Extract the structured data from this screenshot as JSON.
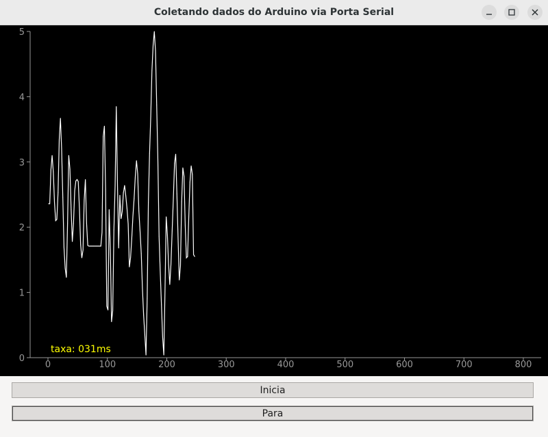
{
  "window": {
    "title": "Coletando dados do Arduino via Porta Serial",
    "controls": [
      "minimize-icon",
      "maximize-icon",
      "close-icon"
    ]
  },
  "plot": {
    "rate_text": "taxa: 031ms",
    "colors": {
      "background": "#000000",
      "line": "#ffffff",
      "axis": "#999999",
      "rate_text": "#ffff00"
    }
  },
  "buttons": {
    "start_label": "Inicia",
    "stop_label": "Para"
  },
  "chart_data": {
    "type": "line",
    "title": "",
    "xlabel": "",
    "ylabel": "",
    "xlim": [
      -30,
      820
    ],
    "ylim": [
      0,
      5
    ],
    "xticks": [
      0,
      100,
      200,
      300,
      400,
      500,
      600,
      700,
      800
    ],
    "yticks": [
      0,
      1,
      2,
      3,
      4,
      5
    ],
    "grid": false,
    "series": [
      {
        "values": [
          [
            1,
            2.36
          ],
          [
            3,
            2.36
          ],
          [
            5,
            2.88
          ],
          [
            7,
            3.1
          ],
          [
            9,
            2.85
          ],
          [
            11,
            2.38
          ],
          [
            13,
            2.1
          ],
          [
            15,
            2.12
          ],
          [
            17,
            2.53
          ],
          [
            19,
            3.34
          ],
          [
            21,
            3.67
          ],
          [
            23,
            3.2
          ],
          [
            25,
            2.46
          ],
          [
            27,
            1.69
          ],
          [
            29,
            1.37
          ],
          [
            31,
            1.23
          ],
          [
            33,
            2.06
          ],
          [
            35,
            3.1
          ],
          [
            37,
            2.89
          ],
          [
            39,
            2.27
          ],
          [
            41,
            1.78
          ],
          [
            43,
            2.06
          ],
          [
            45,
            2.56
          ],
          [
            47,
            2.71
          ],
          [
            49,
            2.73
          ],
          [
            51,
            2.7
          ],
          [
            53,
            2.28
          ],
          [
            55,
            1.73
          ],
          [
            57,
            1.53
          ],
          [
            59,
            1.65
          ],
          [
            61,
            2.42
          ],
          [
            63,
            2.73
          ],
          [
            65,
            2.06
          ],
          [
            67,
            1.72
          ],
          [
            69,
            1.71
          ],
          [
            71,
            1.71
          ],
          [
            73,
            1.71
          ],
          [
            75,
            1.71
          ],
          [
            77,
            1.71
          ],
          [
            79,
            1.71
          ],
          [
            81,
            1.71
          ],
          [
            83,
            1.71
          ],
          [
            85,
            1.71
          ],
          [
            87,
            1.71
          ],
          [
            89,
            1.71
          ],
          [
            91,
            1.92
          ],
          [
            93,
            3.39
          ],
          [
            95,
            3.55
          ],
          [
            97,
            2.58
          ],
          [
            99,
            0.79
          ],
          [
            101,
            0.73
          ],
          [
            103,
            2.27
          ],
          [
            105,
            1.65
          ],
          [
            107,
            0.55
          ],
          [
            109,
            0.72
          ],
          [
            111,
            1.96
          ],
          [
            113,
            2.63
          ],
          [
            115,
            3.85
          ],
          [
            117,
            2.64
          ],
          [
            119,
            1.68
          ],
          [
            121,
            2.49
          ],
          [
            123,
            2.13
          ],
          [
            125,
            2.24
          ],
          [
            127,
            2.53
          ],
          [
            129,
            2.64
          ],
          [
            131,
            2.48
          ],
          [
            133,
            2.29
          ],
          [
            135,
            2.05
          ],
          [
            137,
            1.39
          ],
          [
            139,
            1.53
          ],
          [
            141,
            1.82
          ],
          [
            143,
            2.17
          ],
          [
            145,
            2.44
          ],
          [
            147,
            2.78
          ],
          [
            149,
            3.02
          ],
          [
            151,
            2.82
          ],
          [
            153,
            2.25
          ],
          [
            155,
            1.94
          ],
          [
            157,
            1.6
          ],
          [
            159,
            1.06
          ],
          [
            161,
            0.65
          ],
          [
            163,
            0.35
          ],
          [
            165,
            0.04
          ],
          [
            167,
            0.91
          ],
          [
            169,
            2.38
          ],
          [
            171,
            3.13
          ],
          [
            173,
            3.7
          ],
          [
            175,
            4.4
          ],
          [
            177,
            4.79
          ],
          [
            179,
            5.0
          ],
          [
            181,
            4.7
          ],
          [
            183,
            3.87
          ],
          [
            185,
            3.02
          ],
          [
            187,
            1.86
          ],
          [
            189,
            1.31
          ],
          [
            191,
            0.81
          ],
          [
            193,
            0.31
          ],
          [
            195,
            0.04
          ],
          [
            197,
            1.04
          ],
          [
            199,
            2.16
          ],
          [
            201,
            1.88
          ],
          [
            203,
            1.43
          ],
          [
            205,
            1.12
          ],
          [
            207,
            1.43
          ],
          [
            209,
            1.94
          ],
          [
            211,
            2.43
          ],
          [
            213,
            2.98
          ],
          [
            215,
            3.12
          ],
          [
            217,
            2.51
          ],
          [
            219,
            1.82
          ],
          [
            221,
            1.19
          ],
          [
            223,
            1.41
          ],
          [
            225,
            2.39
          ],
          [
            227,
            2.91
          ],
          [
            229,
            2.78
          ],
          [
            231,
            2.03
          ],
          [
            233,
            1.53
          ],
          [
            235,
            1.55
          ],
          [
            237,
            2.16
          ],
          [
            239,
            2.69
          ],
          [
            241,
            2.94
          ],
          [
            243,
            2.81
          ],
          [
            245,
            1.58
          ],
          [
            247,
            1.55
          ]
        ]
      }
    ]
  }
}
